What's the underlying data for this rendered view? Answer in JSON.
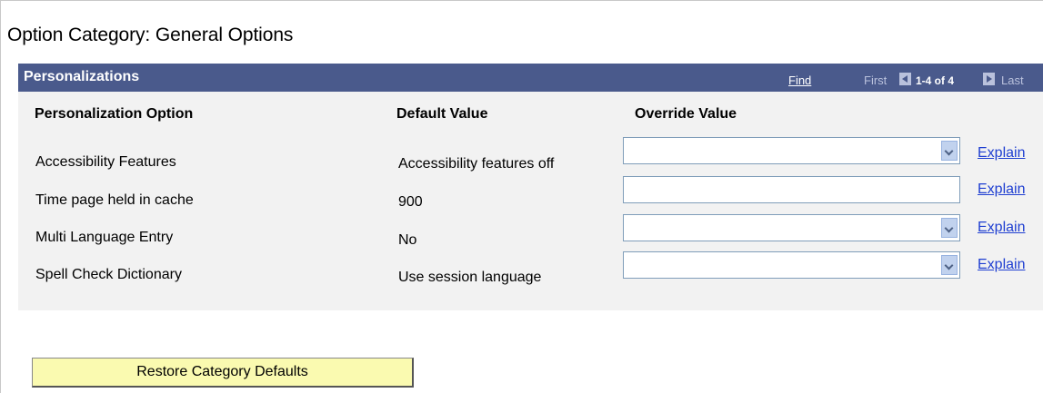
{
  "page": {
    "title": "Option Category:  General Options"
  },
  "grid": {
    "title": "Personalizations",
    "find_label": "Find",
    "nav": {
      "first_label": "First",
      "range": "1-4 of 4",
      "last_label": "Last"
    },
    "columns": [
      "Personalization Option",
      "Default Value",
      "Override Value"
    ],
    "rows": [
      {
        "option": "Accessibility Features",
        "default_value": "Accessibility features off",
        "override_value": "",
        "override_type": "dropdown",
        "explain_label": "Explain"
      },
      {
        "option": "Time page held in cache",
        "default_value": "900",
        "override_value": "",
        "override_type": "text",
        "explain_label": "Explain"
      },
      {
        "option": "Multi Language Entry",
        "default_value": "No",
        "override_value": "",
        "override_type": "dropdown",
        "explain_label": "Explain"
      },
      {
        "option": "Spell Check Dictionary",
        "default_value": "Use session language",
        "override_value": "",
        "override_type": "dropdown",
        "explain_label": "Explain"
      }
    ]
  },
  "actions": {
    "restore_label": "Restore Category Defaults"
  },
  "colors": {
    "header_bg": "#4a5a8c",
    "grid_bg": "#f2f2f2",
    "link": "#1f3fd1",
    "button_bg": "#fafab0"
  },
  "icons": {
    "nav_prev": "left-arrow-icon",
    "nav_next": "right-arrow-icon",
    "dropdown": "chevron-down-icon"
  }
}
